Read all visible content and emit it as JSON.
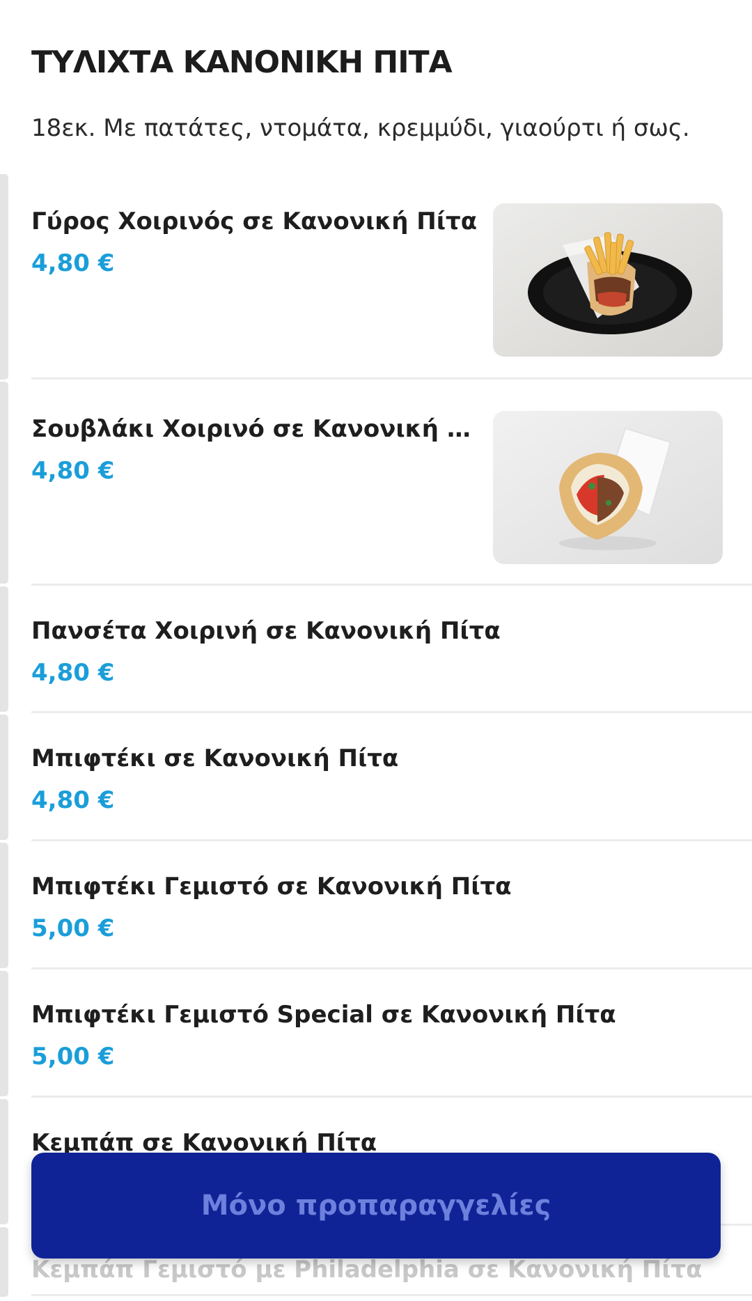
{
  "category": {
    "title": "ΤΥΛΙΧΤΑ ΚΑΝΟΝΙΚΗ ΠΙΤΑ",
    "description": "18εκ. Με πατάτες, ντομάτα, κρεμμύδι, γιαούρτι ή σως."
  },
  "items": [
    {
      "name": "Γύρος Χοιρινός σε Κανονική Πίτα",
      "price": "4,80 €",
      "image": "gyros-pita-photo"
    },
    {
      "name": "Σουβλάκι Χοιρινό σε Κανονική …",
      "price": "4,80 €",
      "image": "souvlaki-pita-photo"
    },
    {
      "name": "Πανσέτα Χοιρινή σε Κανονική Πίτα",
      "price": "4,80 €"
    },
    {
      "name": "Μπιφτέκι σε Κανονική Πίτα",
      "price": "4,80 €"
    },
    {
      "name": "Μπιφτέκι Γεμιστό σε Κανονική Πίτα",
      "price": "5,00 €"
    },
    {
      "name": "Μπιφτέκι Γεμιστό Special σε Κανονική Πίτα",
      "price": "5,00 €"
    },
    {
      "name": "Κεμπάπ σε Κανονική Πίτα"
    },
    {
      "name": "Κεμπάπ Γεμιστό με Philadelphia σε Κανονική Πίτα"
    }
  ],
  "cta": {
    "label": "Μόνο προπαραγγελίες"
  },
  "colors": {
    "price": "#1a9ed9",
    "cta_background": "#0f2397",
    "cta_text": "#6d80dc"
  }
}
